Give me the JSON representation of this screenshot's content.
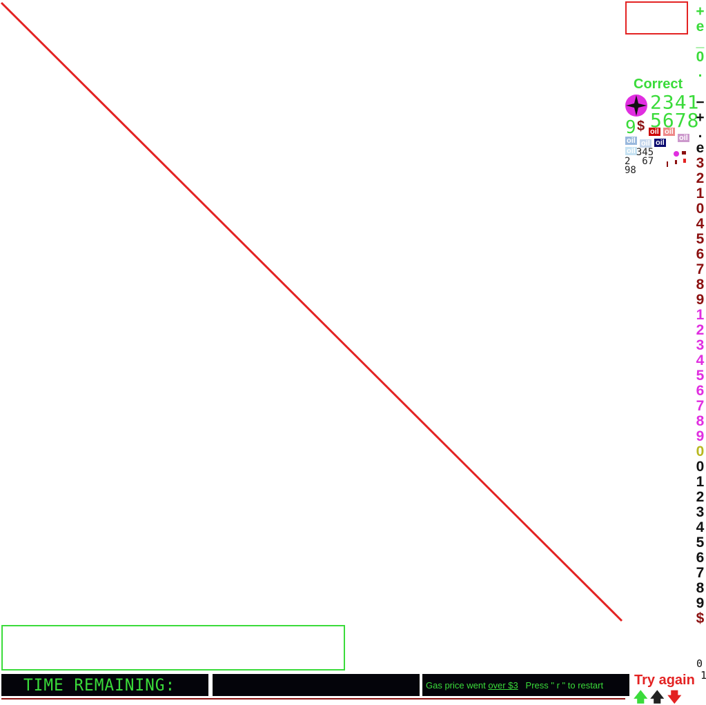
{
  "status": {
    "correct_label": "Correct",
    "try_again_label": "Try again"
  },
  "lcd_digits": {
    "row1": "2341",
    "row2": "5678",
    "single": "9",
    "dollar": "$"
  },
  "oil_tags": [
    {
      "text": "oil",
      "bg": "#cc0000",
      "fg": "#ffffff"
    },
    {
      "text": "oil",
      "bg": "#ee8888",
      "fg": "#ffffff"
    },
    {
      "text": "oil",
      "bg": "#cc99cc",
      "fg": "#ffffff"
    },
    {
      "text": "oil",
      "bg": "#99b8dd",
      "fg": "#ffffff"
    },
    {
      "text": "oil",
      "bg": "#c5d6ec",
      "fg": "#ffffff"
    },
    {
      "text": "oil",
      "bg": "#0a0a6e",
      "fg": "#ffffff"
    },
    {
      "text": "oil",
      "bg": "#c6e2f2",
      "fg": "#ffffff"
    }
  ],
  "tiny_digits": {
    "line1": "  345",
    "line2": "2  67",
    "line3": "98"
  },
  "side_column": [
    {
      "ch": "+",
      "color": "#3adb3a"
    },
    {
      "ch": "e",
      "color": "#3adb3a"
    },
    {
      "ch": "_",
      "color": "#3adb3a"
    },
    {
      "ch": "0",
      "color": "#3adb3a"
    },
    {
      "ch": ".",
      "color": "#3adb3a"
    },
    {
      "ch": "",
      "color": "#3adb3a"
    },
    {
      "ch": "−",
      "color": "#111111"
    },
    {
      "ch": "+",
      "color": "#111111"
    },
    {
      "ch": ".",
      "color": "#111111"
    },
    {
      "ch": "e",
      "color": "#111111"
    },
    {
      "ch": "3",
      "color": "#8b1010"
    },
    {
      "ch": "2",
      "color": "#8b1010"
    },
    {
      "ch": "1",
      "color": "#8b1010"
    },
    {
      "ch": "0",
      "color": "#8b1010"
    },
    {
      "ch": "4",
      "color": "#8b1010"
    },
    {
      "ch": "5",
      "color": "#8b1010"
    },
    {
      "ch": "6",
      "color": "#8b1010"
    },
    {
      "ch": "7",
      "color": "#8b1010"
    },
    {
      "ch": "8",
      "color": "#8b1010"
    },
    {
      "ch": "9",
      "color": "#8b1010"
    },
    {
      "ch": "1",
      "color": "#e02ee0"
    },
    {
      "ch": "2",
      "color": "#e02ee0"
    },
    {
      "ch": "3",
      "color": "#e02ee0"
    },
    {
      "ch": "4",
      "color": "#e02ee0"
    },
    {
      "ch": "5",
      "color": "#e02ee0"
    },
    {
      "ch": "6",
      "color": "#e02ee0"
    },
    {
      "ch": "7",
      "color": "#e02ee0"
    },
    {
      "ch": "8",
      "color": "#e02ee0"
    },
    {
      "ch": "9",
      "color": "#e02ee0"
    },
    {
      "ch": "0",
      "color": "#b8b820"
    },
    {
      "ch": "0",
      "color": "#111111"
    },
    {
      "ch": "1",
      "color": "#111111"
    },
    {
      "ch": "2",
      "color": "#111111"
    },
    {
      "ch": "3",
      "color": "#111111"
    },
    {
      "ch": "4",
      "color": "#111111"
    },
    {
      "ch": "5",
      "color": "#111111"
    },
    {
      "ch": "6",
      "color": "#111111"
    },
    {
      "ch": "7",
      "color": "#111111"
    },
    {
      "ch": "8",
      "color": "#111111"
    },
    {
      "ch": "9",
      "color": "#111111"
    },
    {
      "ch": "$",
      "color": "#8b1010"
    }
  ],
  "side_tail": [
    "0",
    "1"
  ],
  "bottom_bar": {
    "time_label": "TIME REMAINING:",
    "time_value": "",
    "msg_prefix": "Gas price went ",
    "msg_link": "over $3",
    "msg_suffix": "   Press \" r \" to restart"
  },
  "arrows": [
    {
      "icon": "up-arrow-icon",
      "glyph": "🡅",
      "color": "#3adb3a"
    },
    {
      "icon": "up-arrow-icon",
      "glyph": "🡅",
      "color": "#222222"
    },
    {
      "icon": "down-arrow-icon",
      "glyph": "🡇",
      "color": "#e32222"
    }
  ],
  "colors": {
    "lcd_green": "#3adb3a",
    "alert_red": "#e32222",
    "dark_red": "#8b1010",
    "magenta": "#e02ee0",
    "bar_black": "#04040a"
  }
}
